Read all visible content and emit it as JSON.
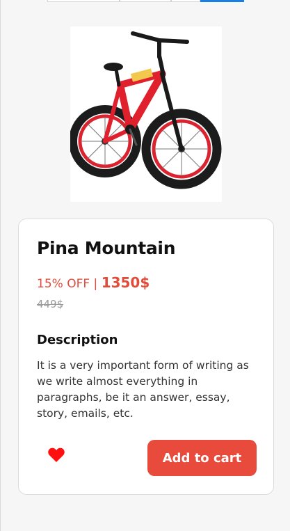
{
  "product": {
    "name": "Pina Mountain",
    "discount": "15% OFF",
    "separator": "|",
    "price": "1350$",
    "old_price": "449$",
    "image": "red-bmx-bike"
  },
  "description": {
    "heading": "Description",
    "text": "It is a very important form of writing as we write almost everything in paragraphs, be it an answer, essay, story, emails, etc."
  },
  "actions": {
    "add_to_cart_label": "Add to cart",
    "favorite_icon": "heart-icon"
  },
  "colors": {
    "accent": "#e84b3c",
    "discount_text": "#e04b3a",
    "heart": "#ff1010",
    "active_tab": "#1a7fe3"
  }
}
